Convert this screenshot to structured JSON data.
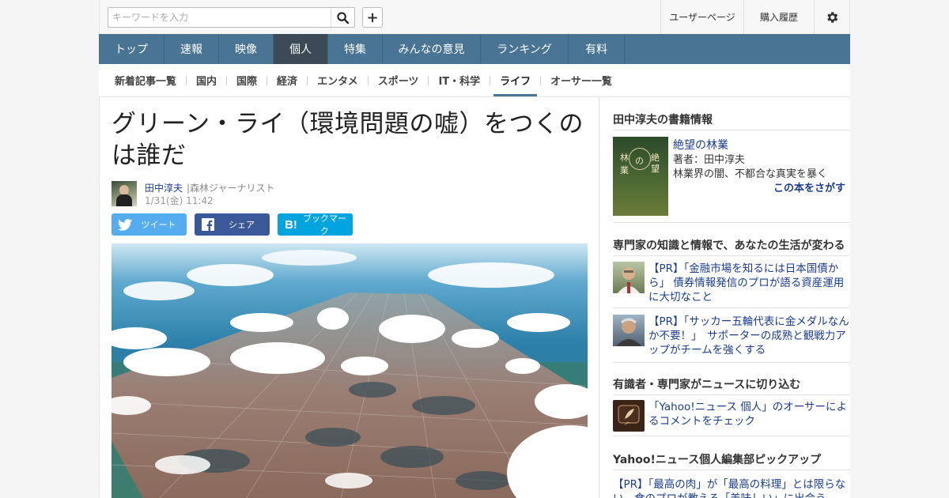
{
  "search": {
    "placeholder": "キーワードを入力"
  },
  "top_links": {
    "user_page": "ユーザーページ",
    "purchase_history": "購入履歴"
  },
  "main_nav": [
    {
      "label": "トップ",
      "active": false
    },
    {
      "label": "速報",
      "active": false
    },
    {
      "label": "映像",
      "active": false
    },
    {
      "label": "個人",
      "active": true
    },
    {
      "label": "特集",
      "active": false
    },
    {
      "label": "みんなの意見",
      "active": false
    },
    {
      "label": "ランキング",
      "active": false
    },
    {
      "label": "有料",
      "active": false
    }
  ],
  "sub_nav": [
    {
      "label": "新着記事一覧",
      "active": false
    },
    {
      "label": "国内",
      "active": false
    },
    {
      "label": "国際",
      "active": false
    },
    {
      "label": "経済",
      "active": false
    },
    {
      "label": "エンタメ",
      "active": false
    },
    {
      "label": "スポーツ",
      "active": false
    },
    {
      "label": "IT・科学",
      "active": false
    },
    {
      "label": "ライフ",
      "active": true
    },
    {
      "label": "オーサー一覧",
      "active": false
    }
  ],
  "article": {
    "title": "グリーン・ライ（環境問題の嘘）をつくのは誰だ",
    "author_name": "田中淳夫",
    "author_role": "|森林ジャーナリスト",
    "date": "1/31(金) 11:42",
    "share": {
      "tweet": "ツイート",
      "facebook": "シェア",
      "hatena": "ブックマーク"
    }
  },
  "sidebar": {
    "books": {
      "heading": "田中淳夫の書籍情報",
      "cover_text": [
        "絶",
        "望",
        "林",
        "業",
        "の"
      ],
      "title": "絶望の林業",
      "author": "著者：田中淳夫",
      "description": "林業界の闇、不都合な真実を暴く",
      "find_link": "この本をさがす"
    },
    "expert": {
      "heading": "専門家の知識と情報で、あなたの生活が変わる",
      "items": [
        {
          "text": "【PR】「金融市場を知るには日本国債から」 債券情報発信のプロが語る資産運用に大切なこと"
        },
        {
          "text": "【PR】「サッカー五輪代表に金メダルなんか不要！」　サポーターの成熟と観戦力アップがチームを強くする"
        }
      ]
    },
    "comment": {
      "heading": "有識者・専門家がニュースに切り込む",
      "text": "「Yahoo!ニュース 個人」のオーサーによるコメントをチェック"
    },
    "pickup": {
      "heading": "Yahoo!ニュース個人編集部ピックアップ",
      "text": "【PR】「最高の肉」が「最高の料理」とは限らない　食のプロが教える「美味しい」に出会う"
    }
  },
  "colors": {
    "nav_bg": "#4a7494",
    "nav_active": "#3b4a56",
    "link": "#1a3d8f",
    "twitter": "#55acee",
    "facebook": "#3b5998",
    "hatena": "#00a4de"
  }
}
